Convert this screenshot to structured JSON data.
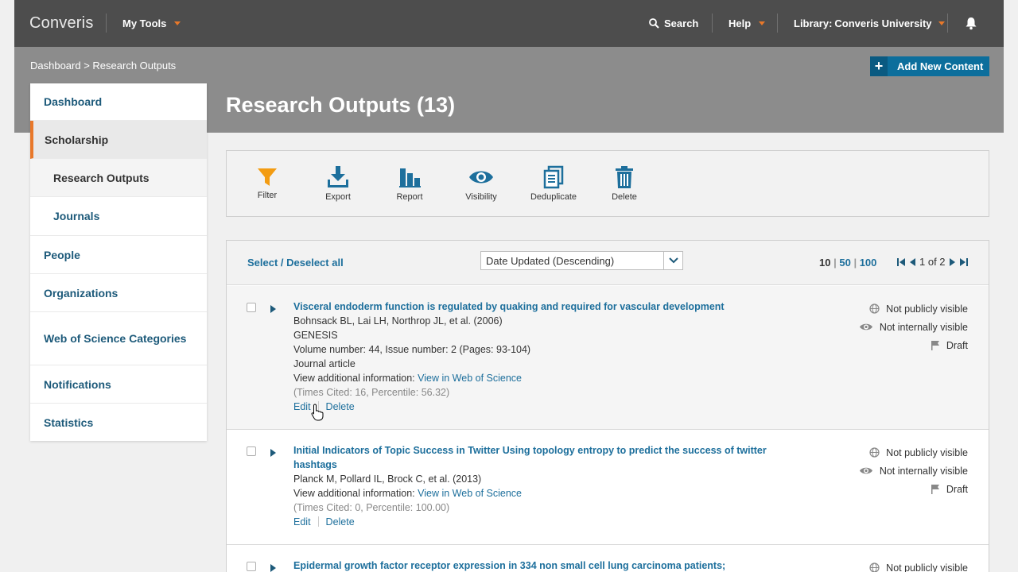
{
  "app": {
    "brand": "Converis"
  },
  "topnav": {
    "my_tools": "My Tools",
    "search": "Search",
    "help": "Help",
    "library_prefix": "Library: ",
    "library_name": "Converis University"
  },
  "breadcrumb": "Dashboard > Research Outputs",
  "add_button": "Add New Content",
  "page_title": "Research Outputs (13)",
  "sidebar": {
    "items": [
      {
        "label": "Dashboard"
      },
      {
        "label": "Scholarship"
      },
      {
        "label": "Research Outputs"
      },
      {
        "label": "Journals"
      },
      {
        "label": "People"
      },
      {
        "label": "Organizations"
      },
      {
        "label": "Web of Science Categories"
      },
      {
        "label": "Notifications"
      },
      {
        "label": "Statistics"
      }
    ]
  },
  "toolbar": {
    "filter": "Filter",
    "export": "Export",
    "report": "Report",
    "visibility": "Visibility",
    "deduplicate": "Deduplicate",
    "delete": "Delete"
  },
  "list": {
    "select_all": "Select / Deselect all",
    "sort_value": "Date Updated (Descending)",
    "page_sizes": [
      "10",
      "50",
      "100"
    ],
    "pager_text": "1 of 2"
  },
  "records": [
    {
      "title": "Visceral endoderm function is regulated by quaking and required for vascular development",
      "authors": "Bohnsack BL, Lai LH, Northrop JL, et al. (2006)",
      "journal": "GENESIS",
      "volume": "Volume number: 44, Issue number: 2 (Pages: 93-104)",
      "type": "Journal article",
      "additional_label": "View additional information: ",
      "additional_link": "View in Web of Science",
      "cited": "(Times Cited: 16, Percentile: 56.32)",
      "edit": "Edit",
      "delete": "Delete",
      "status": [
        "Not publicly visible",
        "Not internally visible",
        "Draft"
      ]
    },
    {
      "title": "Initial Indicators of Topic Success in Twitter Using topology entropy to predict the success of twitter hashtags",
      "authors": "Planck M, Pollard IL, Brock C, et al. (2013)",
      "additional_label": "View additional information: ",
      "additional_link": "View in Web of Science",
      "cited": "(Times Cited: 0, Percentile: 100.00)",
      "edit": "Edit",
      "delete": "Delete",
      "status": [
        "Not publicly visible",
        "Not internally visible",
        "Draft"
      ]
    },
    {
      "title": "Epidermal growth factor receptor expression in 334 non small cell lung carcinoma patients;",
      "status": [
        "Not publicly visible"
      ]
    }
  ],
  "colors": {
    "accent": "#e8782a",
    "link": "#1d6f9c",
    "primary_button": "#0c6e9c"
  }
}
